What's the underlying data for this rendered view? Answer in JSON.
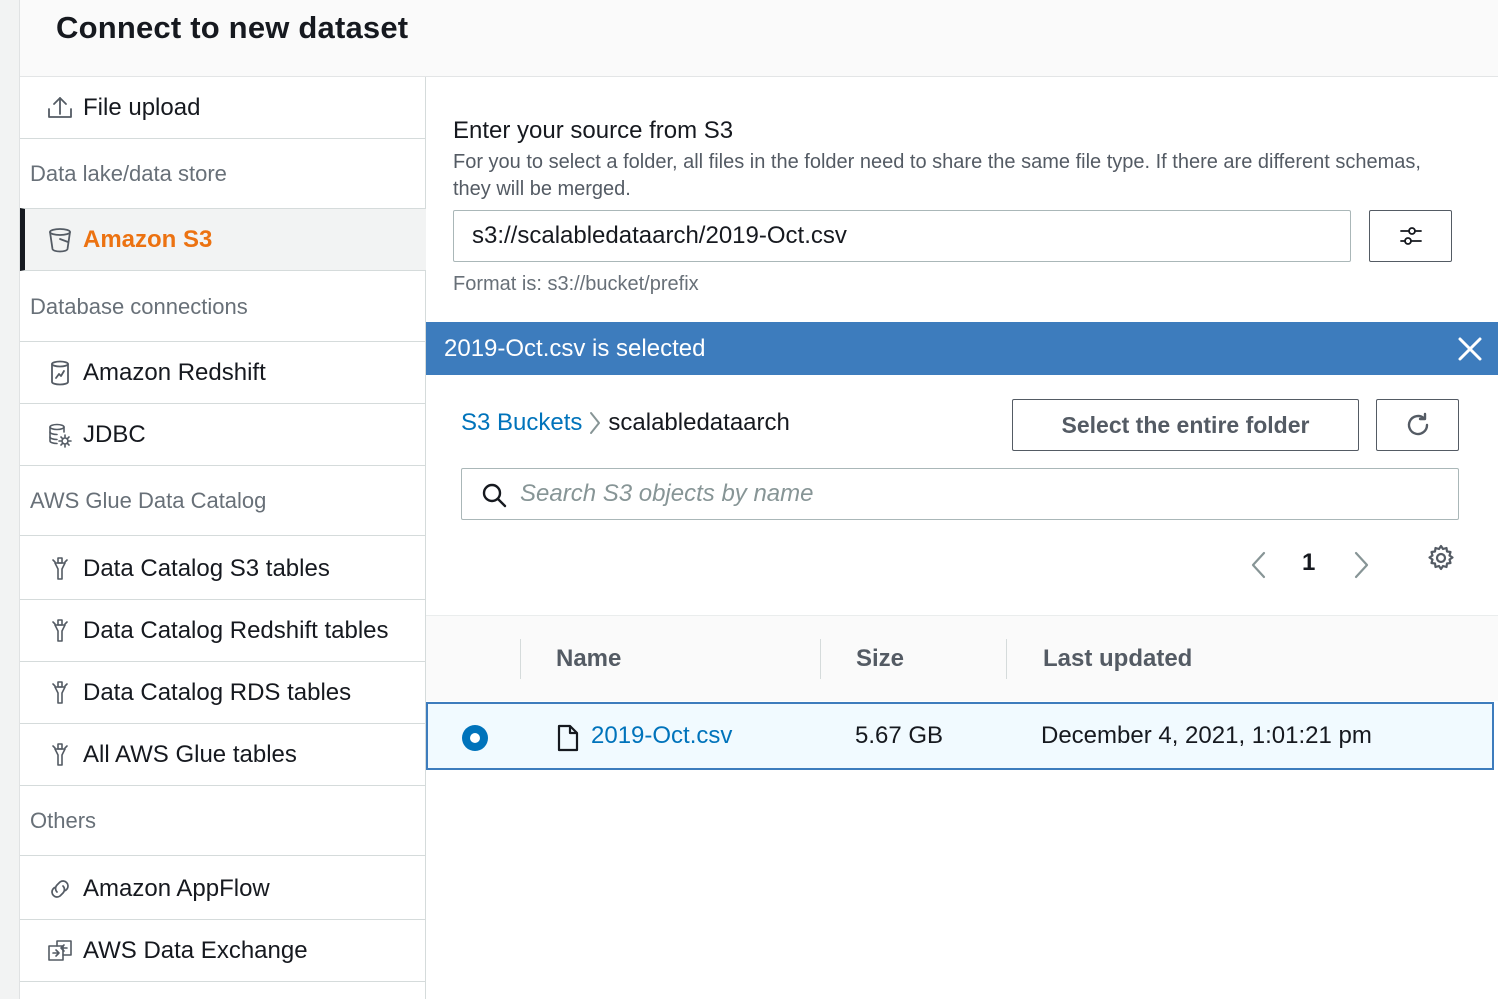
{
  "header": {
    "title": "Connect to new dataset"
  },
  "sidebar": {
    "file_upload": "File upload",
    "sections": {
      "data_lake": "Data lake/data store",
      "database": "Database connections",
      "glue": "AWS Glue Data Catalog",
      "others": "Others"
    },
    "items": {
      "s3": "Amazon S3",
      "redshift": "Amazon Redshift",
      "jdbc": "JDBC",
      "catalog_s3": "Data Catalog S3 tables",
      "catalog_redshift": "Data Catalog Redshift tables",
      "catalog_rds": "Data Catalog RDS tables",
      "all_glue": "All AWS Glue tables",
      "appflow": "Amazon AppFlow",
      "data_exchange": "AWS Data Exchange"
    }
  },
  "source": {
    "label": "Enter your source from S3",
    "description": "For you to select a folder, all files in the folder need to share the same file type. If there are different schemas, they will be merged.",
    "value": "s3://scalabledataarch/2019-Oct.csv",
    "format_hint": "Format is: s3://bucket/prefix"
  },
  "banner": {
    "text": "2019-Oct.csv is selected"
  },
  "browser": {
    "breadcrumb_root": "S3 Buckets",
    "breadcrumb_current": "scalabledataarch",
    "select_folder_label": "Select the entire folder",
    "search_placeholder": "Search S3 objects by name",
    "page": "1",
    "columns": {
      "name": "Name",
      "size": "Size",
      "updated": "Last updated"
    },
    "rows": [
      {
        "name": "2019-Oct.csv",
        "size": "5.67 GB",
        "updated": "December 4, 2021, 1:01:21 pm",
        "selected": true
      }
    ]
  },
  "colors": {
    "accent_orange": "#ec7211",
    "link_blue": "#0073bb",
    "banner_blue": "#3d7cbd"
  }
}
